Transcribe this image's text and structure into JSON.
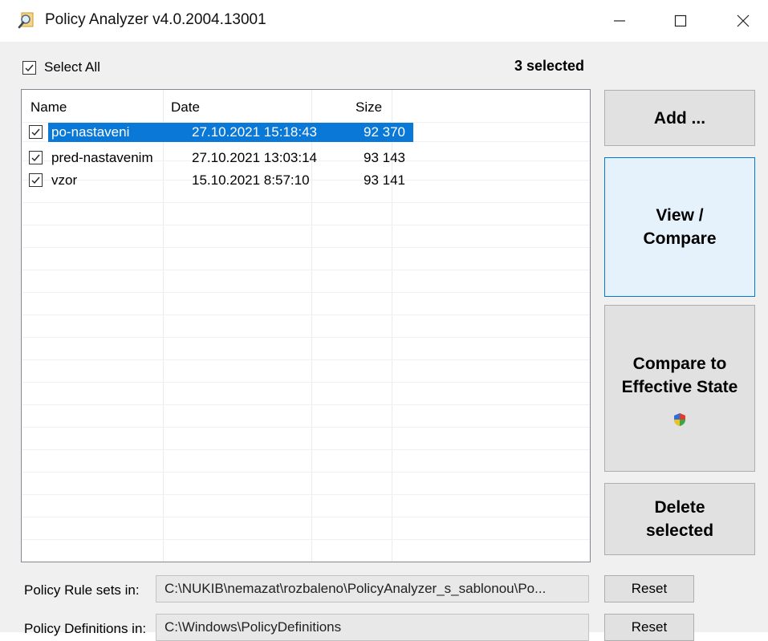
{
  "window": {
    "title": "Policy Analyzer v4.0.2004.13001"
  },
  "toolbar": {
    "select_all_label": "Select All",
    "selected_count": "3 selected"
  },
  "list": {
    "columns": {
      "name": "Name",
      "date": "Date",
      "size": "Size"
    },
    "rows": [
      {
        "name": "po-nastaveni",
        "date": "27.10.2021 15:18:43",
        "size": "92 370",
        "checked": true,
        "selected": true
      },
      {
        "name": "pred-nastavenim",
        "date": "27.10.2021 13:03:14",
        "size": "93 143",
        "checked": true,
        "selected": false
      },
      {
        "name": "vzor",
        "date": "15.10.2021 8:57:10",
        "size": "93 141",
        "checked": true,
        "selected": false
      }
    ]
  },
  "buttons": {
    "add_label": "Add ...",
    "view_compare_label": "View / Compare",
    "compare_effective_label": "Compare to Effective State",
    "delete_selected_label": "Delete selected",
    "reset_label": "Reset"
  },
  "paths": {
    "rule_sets_label": "Policy Rule sets in:",
    "rule_sets_value": "C:\\NUKIB\\nemazat\\rozbaleno\\PolicyAnalyzer_s_sablonou\\Po...",
    "definitions_label": "Policy Definitions in:",
    "definitions_value": "C:\\Windows\\PolicyDefinitions"
  },
  "colors": {
    "selection": "#0a78d7",
    "focused_button": "#e5f1fb",
    "focus_border": "#0078d7",
    "window_bg": "#f0f0f0"
  },
  "icons": [
    "app-magnifier-icon",
    "minimize-icon",
    "maximize-icon",
    "close-icon",
    "check-icon",
    "shield-icon"
  ]
}
